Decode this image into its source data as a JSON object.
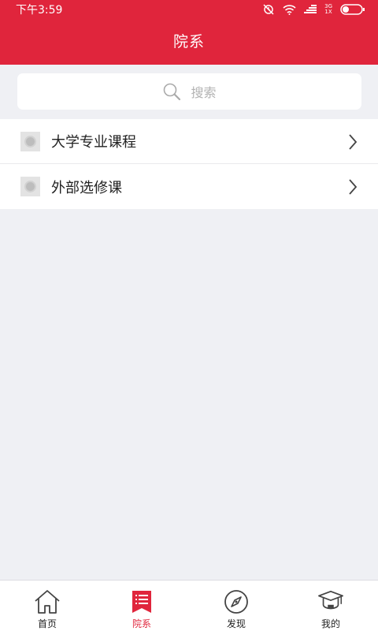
{
  "status_bar": {
    "time": "下午3:59",
    "network_top": "3G",
    "network_bottom": "1X"
  },
  "header": {
    "title": "院系"
  },
  "search": {
    "placeholder": "搜索"
  },
  "list": {
    "items": [
      {
        "label": "大学专业课程"
      },
      {
        "label": "外部选修课"
      }
    ]
  },
  "tabbar": {
    "items": [
      {
        "label": "首页",
        "icon": "home-icon",
        "active": false
      },
      {
        "label": "院系",
        "icon": "list-bookmark-icon",
        "active": true
      },
      {
        "label": "发现",
        "icon": "compass-icon",
        "active": false
      },
      {
        "label": "我的",
        "icon": "graduation-cap-icon",
        "active": false
      }
    ]
  },
  "colors": {
    "accent": "#e0253c",
    "background": "#eff0f4"
  }
}
